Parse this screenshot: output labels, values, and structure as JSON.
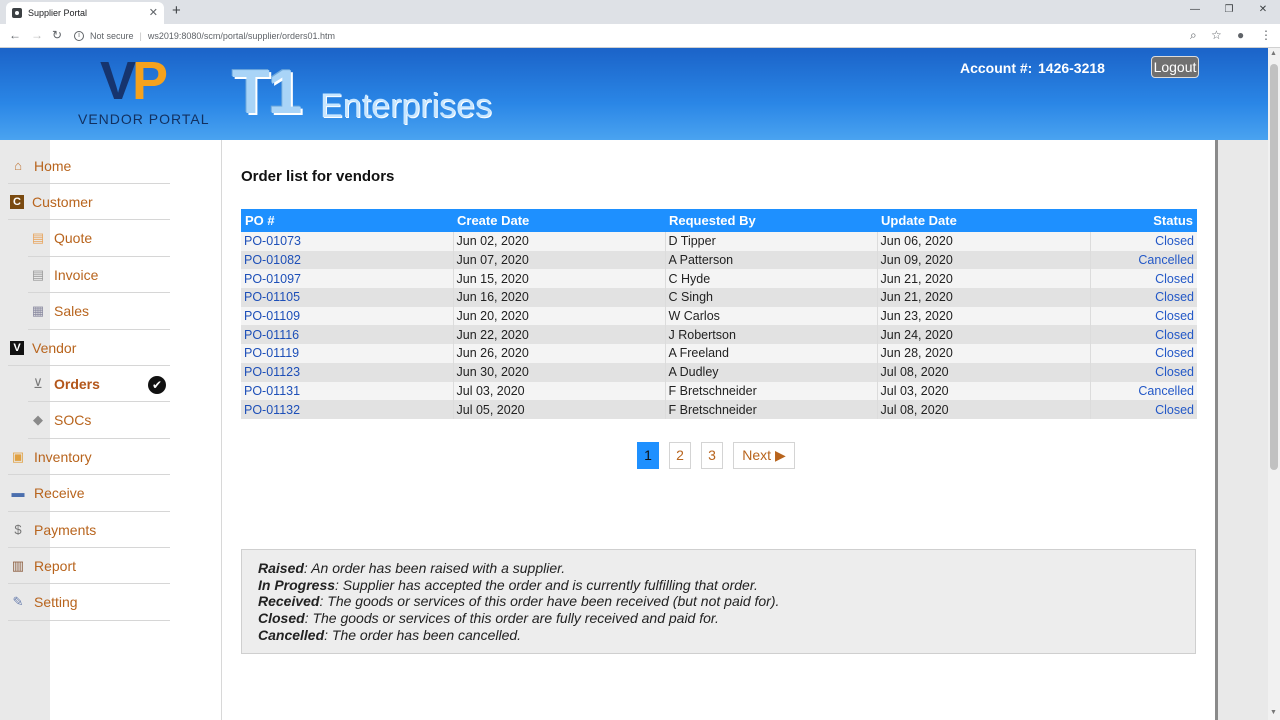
{
  "browser": {
    "tab_title": "Supplier Portal",
    "close_tab": "✕",
    "new_tab": "+",
    "url_security": "Not secure",
    "url": "ws2019:8080/scm/portal/supplier/orders01.htm",
    "win_min": "—",
    "win_restore": "❐",
    "win_close": "✕"
  },
  "header": {
    "logo_v": "V",
    "logo_p": "P",
    "logo_subtitle": "VENDOR PORTAL",
    "brand_t1": "T1",
    "brand_name": "Enterprises",
    "account_label": "Account #:",
    "account_number": "1426-3218",
    "logout_label": "Logout",
    "gradient_top": "#1b63c8",
    "gradient_bottom": "#4aa3f0"
  },
  "sidebar": {
    "items": [
      {
        "label": "Home",
        "icon": "home-icon",
        "glyph": "⌂"
      },
      {
        "label": "Customer",
        "icon": "customer-icon",
        "glyph": "C"
      },
      {
        "label": "Quote",
        "icon": "quote-icon",
        "glyph": "▤"
      },
      {
        "label": "Invoice",
        "icon": "invoice-icon",
        "glyph": "▤"
      },
      {
        "label": "Sales",
        "icon": "sales-icon",
        "glyph": "▦"
      },
      {
        "label": "Vendor",
        "icon": "vendor-icon",
        "glyph": "V"
      },
      {
        "label": "Orders",
        "icon": "cart-icon",
        "glyph": "🛒",
        "active": true
      },
      {
        "label": "SOCs",
        "icon": "tag-icon",
        "glyph": "◆"
      },
      {
        "label": "Inventory",
        "icon": "box-icon",
        "glyph": "▣"
      },
      {
        "label": "Receive",
        "icon": "truck-icon",
        "glyph": "▬"
      },
      {
        "label": "Payments",
        "icon": "dollar-icon",
        "glyph": "$"
      },
      {
        "label": "Report",
        "icon": "report-icon",
        "glyph": "▥"
      },
      {
        "label": "Setting",
        "icon": "wrench-icon",
        "glyph": "✎"
      }
    ],
    "active_check": "✔"
  },
  "main": {
    "title": "Order list for vendors",
    "columns": [
      "PO #",
      "Create Date",
      "Requested By",
      "Update Date",
      "Status"
    ],
    "rows": [
      [
        "PO-01073",
        "Jun 02, 2020",
        "D Tipper",
        "Jun 06, 2020",
        "Closed"
      ],
      [
        "PO-01082",
        "Jun 07, 2020",
        "A Patterson",
        "Jun 09, 2020",
        "Cancelled"
      ],
      [
        "PO-01097",
        "Jun 15, 2020",
        "C Hyde",
        "Jun 21, 2020",
        "Closed"
      ],
      [
        "PO-01105",
        "Jun 16, 2020",
        "C Singh",
        "Jun 21, 2020",
        "Closed"
      ],
      [
        "PO-01109",
        "Jun 20, 2020",
        "W Carlos",
        "Jun 23, 2020",
        "Closed"
      ],
      [
        "PO-01116",
        "Jun 22, 2020",
        "J Robertson",
        "Jun 24, 2020",
        "Closed"
      ],
      [
        "PO-01119",
        "Jun 26, 2020",
        "A Freeland",
        "Jun 28, 2020",
        "Closed"
      ],
      [
        "PO-01123",
        "Jun 30, 2020",
        "A Dudley",
        "Jul 08, 2020",
        "Closed"
      ],
      [
        "PO-01131",
        "Jul 03, 2020",
        "F Bretschneider",
        "Jul 03, 2020",
        "Cancelled"
      ],
      [
        "PO-01132",
        "Jul 05, 2020",
        "F Bretschneider",
        "Jul 08, 2020",
        "Closed"
      ]
    ],
    "pagination": {
      "pages": [
        "1",
        "2",
        "3"
      ],
      "current": "1",
      "next_label": "Next ▶"
    },
    "legend": [
      {
        "term": "Raised",
        "desc": ": An order has been raised with a supplier."
      },
      {
        "term": "In Progress",
        "desc": ": Supplier has accepted the order and is currently fulfilling that order."
      },
      {
        "term": "Received",
        "desc": ": The goods or services of this order have been received (but not paid for)."
      },
      {
        "term": "Closed",
        "desc": ": The goods or services of this order are fully received and paid for."
      },
      {
        "term": "Cancelled",
        "desc": ": The order has been cancelled."
      }
    ],
    "colors": {
      "table_header": "#1e90ff",
      "link": "#1d4fb8",
      "sidebar_text": "#b8641d"
    }
  }
}
